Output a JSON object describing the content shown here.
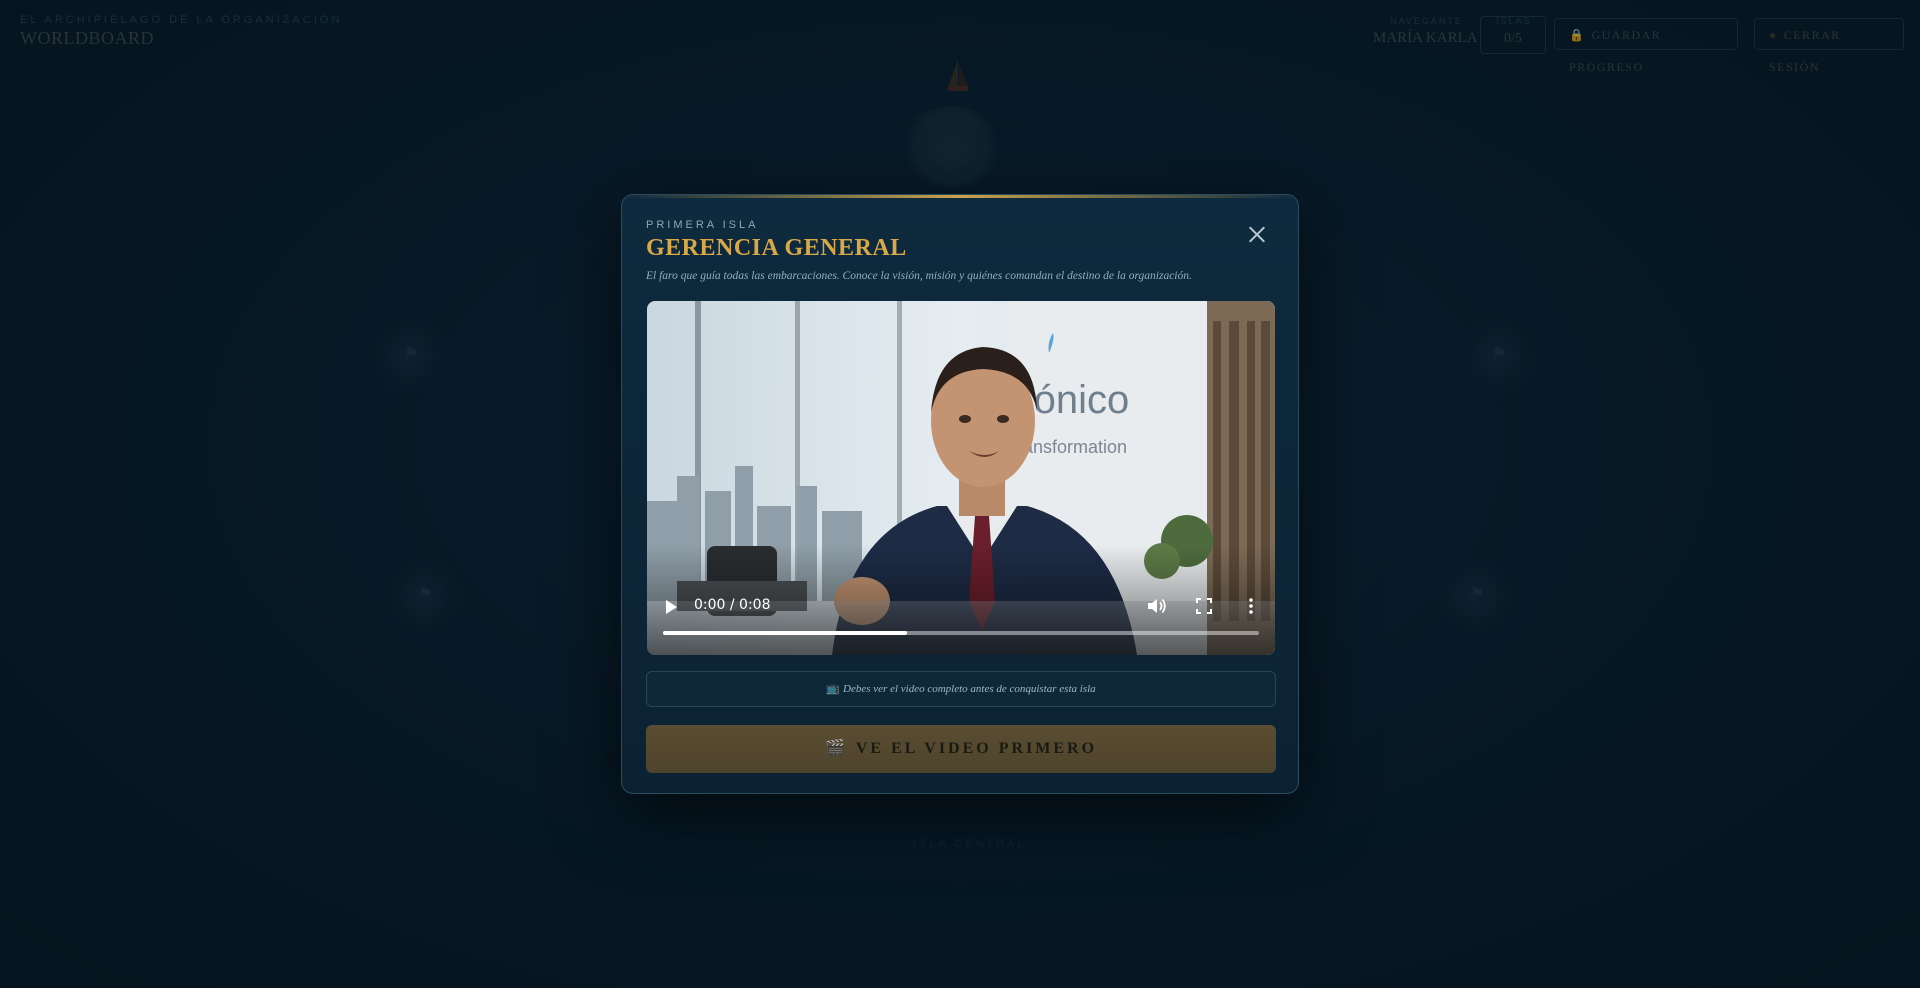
{
  "app": {
    "kicker": "EL ARCHIPIÉLAGO DE LA ORGANIZACIÓN",
    "title": "WORLDBOARD"
  },
  "topbar": {
    "user_label": "NAVEGANTE",
    "user_name": "MARÍA KARLA",
    "score_label": "ISLAS",
    "score_value": "0/5",
    "save_label": "GUARDAR PROGRESO",
    "logout_label": "CERRAR SESIÓN"
  },
  "background": {
    "caption": "ISLA CENTRAL"
  },
  "modal": {
    "kicker": "PRIMERA ISLA",
    "title": "GERENCIA GENERAL",
    "subtitle": "El faro que guía todas las embarcaciones. Conoce la visión, misión y quiénes comandan el destino de la organización.",
    "close_icon": "close-icon",
    "video": {
      "time": "0:00 / 0:08",
      "progress_fraction": 0.41,
      "logo_text": "Kónico",
      "logo_sub": "transformation"
    },
    "notice": {
      "icon": "📺",
      "text": "Debes ver el video completo antes de conquistar esta isla"
    },
    "cta": {
      "icon": "🎬",
      "label": "VE EL VIDEO PRIMERO"
    }
  },
  "colors": {
    "gold": "#c9a24a",
    "title_gold": "#d9a946",
    "navy": "#0b2233"
  }
}
